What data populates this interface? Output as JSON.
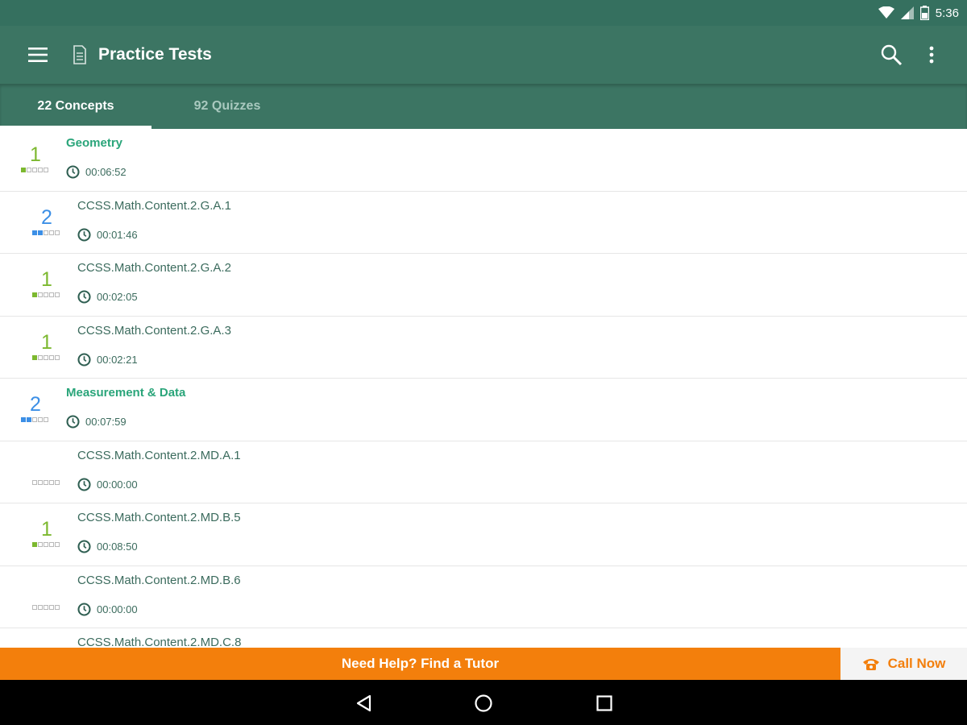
{
  "status_bar": {
    "time": "5:36",
    "icons": [
      "wifi-icon",
      "cell-signal-icon",
      "battery-icon"
    ]
  },
  "app_bar": {
    "title": "Practice Tests",
    "icons": [
      "menu-icon",
      "document-icon",
      "search-icon",
      "more-vert-icon"
    ]
  },
  "tabs": [
    {
      "label": "22 Concepts",
      "selected": true
    },
    {
      "label": "92 Quizzes",
      "selected": false
    }
  ],
  "list": [
    {
      "title": "Geometry",
      "time": "00:06:52",
      "level": "1",
      "level_color": "#7cb82f",
      "filled": 1,
      "kind": "category"
    },
    {
      "title": "CCSS.Math.Content.2.G.A.1",
      "time": "00:01:46",
      "level": "2",
      "level_color": "#3c8fe6",
      "filled": 2,
      "kind": "item"
    },
    {
      "title": "CCSS.Math.Content.2.G.A.2",
      "time": "00:02:05",
      "level": "1",
      "level_color": "#7cb82f",
      "filled": 1,
      "kind": "item"
    },
    {
      "title": "CCSS.Math.Content.2.G.A.3",
      "time": "00:02:21",
      "level": "1",
      "level_color": "#7cb82f",
      "filled": 1,
      "kind": "item"
    },
    {
      "title": "Measurement & Data",
      "time": "00:07:59",
      "level": "2",
      "level_color": "#3c8fe6",
      "filled": 2,
      "kind": "category"
    },
    {
      "title": "CCSS.Math.Content.2.MD.A.1",
      "time": "00:00:00",
      "level": "",
      "level_color": "#b9b9b9",
      "filled": 0,
      "kind": "item"
    },
    {
      "title": "CCSS.Math.Content.2.MD.B.5",
      "time": "00:08:50",
      "level": "1",
      "level_color": "#7cb82f",
      "filled": 1,
      "kind": "item"
    },
    {
      "title": "CCSS.Math.Content.2.MD.B.6",
      "time": "00:00:00",
      "level": "",
      "level_color": "#b9b9b9",
      "filled": 0,
      "kind": "item"
    },
    {
      "title": "CCSS.Math.Content.2.MD.C.8",
      "time": "",
      "level": "",
      "level_color": "#b9b9b9",
      "filled": 0,
      "kind": "item"
    }
  ],
  "banner": {
    "text": "Need Help? Find a Tutor",
    "call_label": "Call Now"
  },
  "colors": {
    "primary": "#3c7563",
    "accent": "#f37f0c",
    "category_text": "#2aa57a"
  },
  "nav_bar": {
    "icons": [
      "back-icon",
      "home-icon",
      "recents-icon"
    ]
  }
}
